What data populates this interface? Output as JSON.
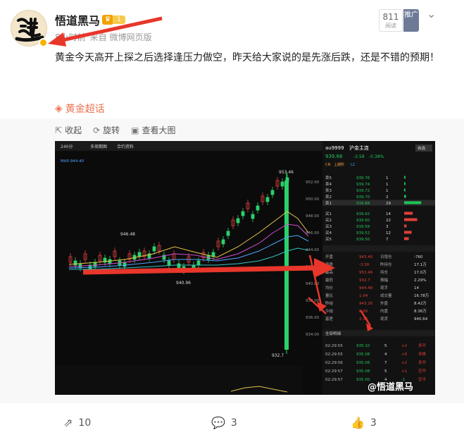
{
  "post": {
    "author": "悟道黑马",
    "vip_level": "1",
    "time": "8小时前",
    "source": "来自 微博网页版",
    "read_count": "811",
    "read_label": "阅读",
    "promote_label": "推广",
    "text": "黄金今天高开上探之后选择逢压力做空，昨天给大家说的是先涨后跌，还是不错的预期！",
    "topic": "黄金超话"
  },
  "media_actions": {
    "collapse": "收起",
    "rotate": "旋转",
    "view_large": "查看大图"
  },
  "chart": {
    "tf": "240分",
    "tab1": "多周期图",
    "tab2": "合约资料",
    "ma": "MA5:944.40",
    "symbol": "au9999",
    "name": "沪金主连",
    "price": "939.68",
    "change": "-3.58",
    "pct": "-0.38%",
    "tag1": "CN",
    "tag2": "上期所",
    "tag3": "L2",
    "btn": "自选",
    "high_label": "953.46",
    "low_label": "932.7",
    "mark1": "946.48",
    "mark2": "940.96",
    "axis": [
      "952.00",
      "950.00",
      "948.00",
      "946.00",
      "944.00",
      "942.00",
      "940.00",
      "938.00",
      "936.00",
      "934.00"
    ],
    "asks": [
      {
        "label": "卖5",
        "price": "939.76",
        "vol": "1"
      },
      {
        "label": "卖4",
        "price": "939.74",
        "vol": "1"
      },
      {
        "label": "卖3",
        "price": "939.72",
        "vol": "1"
      },
      {
        "label": "卖2",
        "price": "939.70",
        "vol": "2"
      },
      {
        "label": "卖1",
        "price": "939.68",
        "vol": "29"
      }
    ],
    "bids": [
      {
        "label": "买1",
        "price": "939.62",
        "vol": "14"
      },
      {
        "label": "买2",
        "price": "939.60",
        "vol": "22"
      },
      {
        "label": "买3",
        "price": "939.58",
        "vol": "3"
      },
      {
        "label": "买4",
        "price": "939.52",
        "vol": "12"
      },
      {
        "label": "买5",
        "price": "939.50",
        "vol": "7"
      }
    ],
    "stats": [
      {
        "k": "开盘",
        "v": "943.40",
        "k2": "日增仓",
        "v2": "-760"
      },
      {
        "k": "涨跌",
        "v": "-3.58",
        "k2": "昨持仓",
        "v2": "17.1万"
      },
      {
        "k": "最高",
        "v": "953.46",
        "k2": "持仓",
        "v2": "17.0万"
      },
      {
        "k": "最低",
        "v": "932.7",
        "k2": "振幅",
        "v2": "2.29%"
      },
      {
        "k": "均价",
        "v": "944.48",
        "k2": "现手",
        "v2": "14"
      },
      {
        "k": "量比",
        "v": "1.04",
        "k2": "成交量",
        "v2": "16.78万"
      },
      {
        "k": "昨结",
        "v": "943.26",
        "k2": "外盘",
        "v2": "8.42万"
      },
      {
        "k": "今结",
        "v": "0.00",
        "k2": "内盘",
        "v2": "8.36万"
      },
      {
        "k": "基差",
        "v": "2.30",
        "k2": "现货",
        "v2": "940.64"
      }
    ],
    "ticks_header": "全部明细",
    "ticks": [
      {
        "t": "02:29:55",
        "p": "935.10",
        "v": "5",
        "d": "+2",
        "s": "多开"
      },
      {
        "t": "02:29:55",
        "p": "935.08",
        "v": "4",
        "d": "+0",
        "s": "多换"
      },
      {
        "t": "02:29:56",
        "p": "935.08",
        "v": "7",
        "d": "+2",
        "s": "多开"
      },
      {
        "t": "02:29:57",
        "p": "935.08",
        "v": "5",
        "d": "+1",
        "s": "空开"
      },
      {
        "t": "02:29:57",
        "p": "935.00",
        "v": "4",
        "d": "-1",
        "s": "空平"
      }
    ],
    "watermark": "@悟道黑马"
  },
  "footer": {
    "reposts": "10",
    "comments": "3",
    "likes": "3"
  }
}
